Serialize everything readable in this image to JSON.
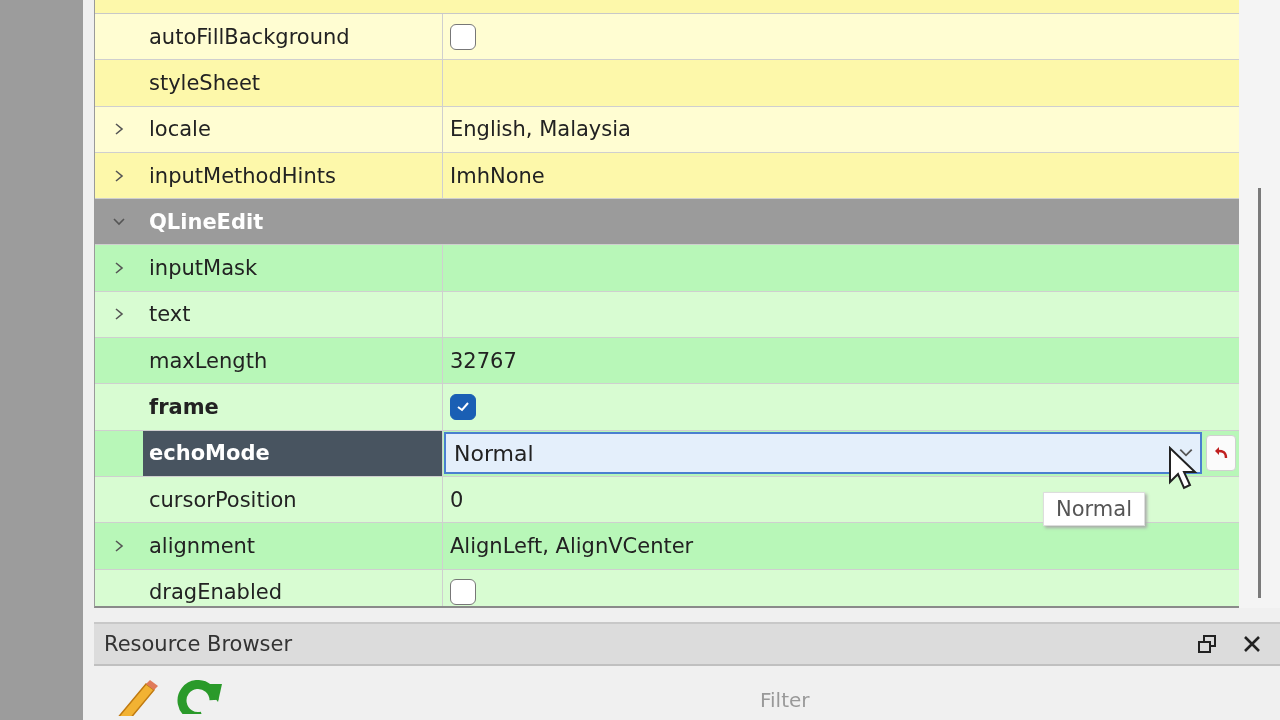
{
  "property_editor": {
    "rows": [
      {
        "kind": "checkbox",
        "name": "autoFillBackground",
        "checked": false,
        "expandable": false,
        "modified": false,
        "selected": false,
        "color": "#fffdd2"
      },
      {
        "kind": "text",
        "name": "styleSheet",
        "expandable": false,
        "modified": false,
        "selected": false,
        "color": "#fdf8aa"
      },
      {
        "kind": "text",
        "name": "locale",
        "value": "English, Malaysia",
        "expandable": true,
        "modified": false,
        "selected": false,
        "color": "#fffdd2"
      },
      {
        "kind": "text",
        "name": "inputMethodHints",
        "value": "ImhNone",
        "expandable": true,
        "modified": false,
        "selected": false,
        "color": "#fdf8aa"
      },
      {
        "kind": "group",
        "name": "QLineEdit",
        "expanded": true
      },
      {
        "kind": "text",
        "name": "inputMask",
        "expandable": true,
        "modified": false,
        "selected": false,
        "color": "#b8f7b8"
      },
      {
        "kind": "text",
        "name": "text",
        "expandable": true,
        "modified": false,
        "selected": false,
        "color": "#d8fcd2"
      },
      {
        "kind": "text",
        "name": "maxLength",
        "value": "32767",
        "expandable": false,
        "modified": false,
        "selected": false,
        "color": "#b8f7b8"
      },
      {
        "kind": "checkbox",
        "name": "frame",
        "checked": true,
        "expandable": false,
        "modified": true,
        "selected": false,
        "color": "#d8fcd2"
      },
      {
        "kind": "combo",
        "name": "echoMode",
        "value": "Normal",
        "expandable": false,
        "modified": true,
        "selected": true,
        "color": "#b8f7b8"
      },
      {
        "kind": "text",
        "name": "cursorPosition",
        "value": "0",
        "expandable": false,
        "modified": false,
        "selected": false,
        "color": "#d8fcd2"
      },
      {
        "kind": "text",
        "name": "alignment",
        "value": "AlignLeft, AlignVCenter",
        "expandable": true,
        "modified": false,
        "selected": false,
        "color": "#b8f7b8"
      },
      {
        "kind": "checkbox",
        "name": "dragEnabled",
        "checked": false,
        "expandable": false,
        "modified": false,
        "selected": false,
        "color": "#d8fcd2"
      }
    ]
  },
  "tooltip": {
    "text": "Normal"
  },
  "resource_browser": {
    "title": "Resource Browser",
    "filter": {
      "placeholder": "Filter"
    }
  }
}
